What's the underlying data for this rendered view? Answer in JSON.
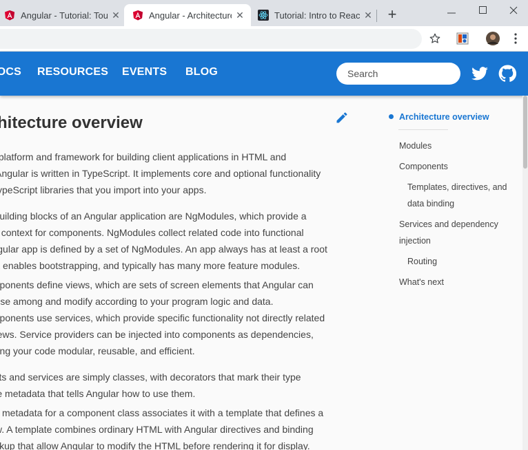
{
  "browser": {
    "tabs": [
      {
        "title": "Angular - Tutorial: Tour of Heroes",
        "active": false,
        "icon": "angular-icon"
      },
      {
        "title": "Angular - Architecture overview",
        "active": true,
        "icon": "angular-icon"
      },
      {
        "title": "Tutorial: Intro to React",
        "active": false,
        "icon": "react-icon"
      }
    ],
    "new_tab": "+",
    "close_glyph": "✕",
    "window_controls": {
      "minimize": "—",
      "maximize": "☐",
      "close": "✕"
    }
  },
  "nav": {
    "links": [
      "DOCS",
      "RESOURCES",
      "EVENTS",
      "BLOG"
    ],
    "search_placeholder": "Search",
    "brand_color": "#1976d2"
  },
  "article": {
    "title": "Architecture overview",
    "paragraphs": [
      {
        "lines": [
          "Angular is a platform and framework for building client applications in HTML and",
          "TypeScript. Angular is written in TypeScript. It implements core and optional functionality",
          "as a set of TypeScript libraries that you import into your apps."
        ]
      },
      {
        "lines": [
          "The basic building blocks of an Angular application are NgModules, which provide a",
          "compilation context for components. NgModules collect related code into functional",
          "sets; an Angular app is defined by a set of NgModules. An app always has at least a root",
          "module that enables bootstrapping, and typically has many more feature modules."
        ]
      },
      {
        "lines": [
          "Components define views, which are sets of screen elements that Angular can",
          "choose among and modify according to your program logic and data.",
          "Components use services, which provide specific functionality not directly related",
          "to views. Service providers can be injected into components as dependencies,",
          "making your code modular, reusable, and efficient."
        ]
      },
      {
        "lines": [
          "Components and services are simply classes, with decorators that mark their type",
          "and provide metadata that tells Angular how to use them."
        ]
      },
      {
        "lines": [
          "The metadata for a component class associates it with a template that defines a",
          "view. A template combines ordinary HTML with Angular directives and binding",
          "markup that allow Angular to modify the HTML before rendering it for display."
        ]
      }
    ]
  },
  "toc": {
    "items": [
      {
        "label": "Architecture overview",
        "active": true
      },
      {
        "label": "Modules"
      },
      {
        "label": "Components"
      },
      {
        "label": "Templates, directives, and"
      },
      {
        "label": "data binding"
      },
      {
        "label": "Services and dependency"
      },
      {
        "label": "injection"
      },
      {
        "label": "Routing"
      },
      {
        "label": "What's next"
      }
    ]
  }
}
